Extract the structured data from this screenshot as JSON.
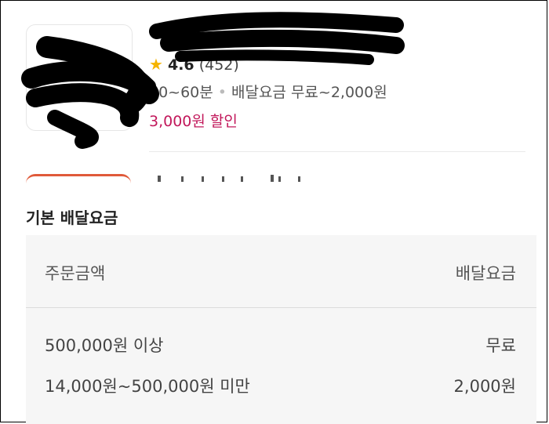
{
  "store": {
    "rating": "4.6",
    "review_count": "(452)",
    "delivery_time": "30~60분",
    "delivery_fee_range": "배달요금 무료~2,000원",
    "discount": "3,000원 할인"
  },
  "fees": {
    "section_title": "기본 배달요금",
    "header": {
      "condition": "주문금액",
      "fee": "배달요금"
    },
    "rows": [
      {
        "condition": "500,000원 이상",
        "fee": "무료"
      },
      {
        "condition": "14,000원~500,000원 미만",
        "fee": "2,000원"
      }
    ]
  },
  "colors": {
    "star": "#f5b400",
    "discount": "#c2185b",
    "table_bg": "#f6f6f6",
    "redaction": "#000000"
  },
  "icons": {
    "rating": "star-icon"
  }
}
